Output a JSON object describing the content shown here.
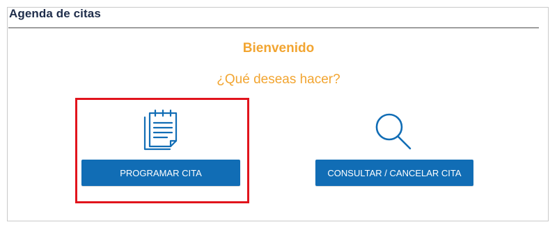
{
  "header": {
    "title": "Agenda de citas"
  },
  "welcome": {
    "title": "Bienvenido",
    "question": "¿Qué deseas hacer?"
  },
  "options": [
    {
      "icon": "notepad-icon",
      "label": "PROGRAMAR CITA"
    },
    {
      "icon": "search-icon",
      "label": "CONSULTAR / CANCELAR CITA"
    }
  ],
  "colors": {
    "accent_orange": "#f2a531",
    "button_blue": "#116db5",
    "highlight_red": "#e1141c",
    "title_navy": "#1f2d4a"
  }
}
